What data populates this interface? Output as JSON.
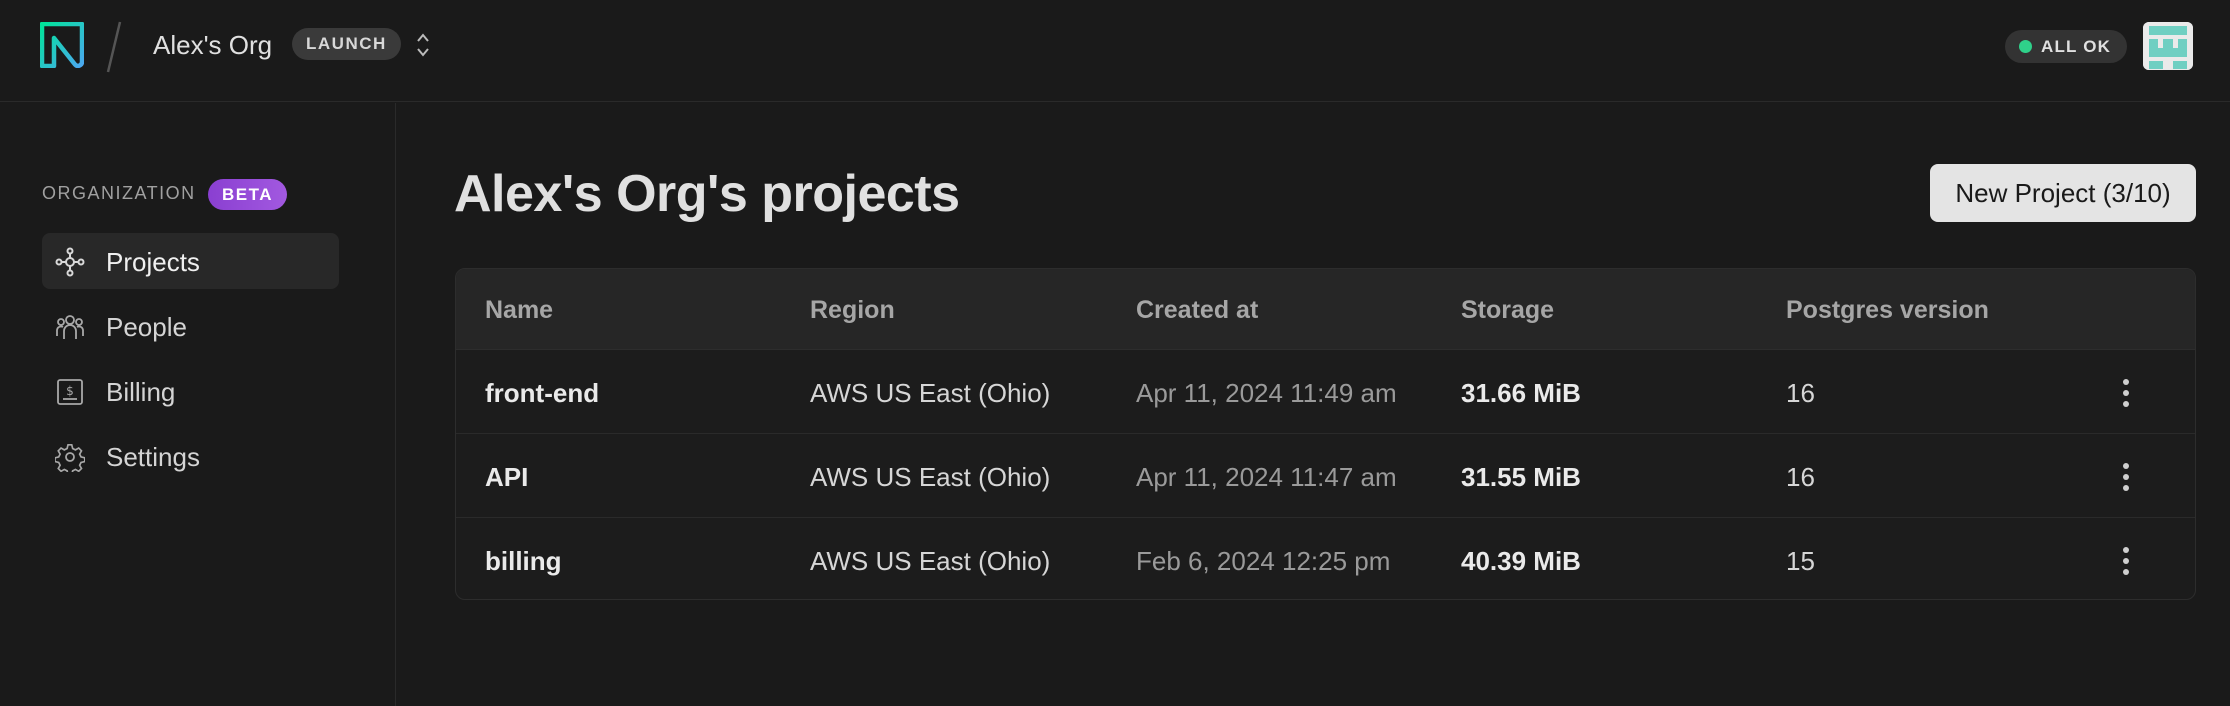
{
  "header": {
    "org_name": "Alex's Org",
    "plan_badge": "LAUNCH",
    "status_label": "ALL OK",
    "status_color": "#2fd18a"
  },
  "sidebar": {
    "section_title": "ORGANIZATION",
    "section_badge": "BETA",
    "items": [
      {
        "label": "Projects",
        "icon": "projects-icon",
        "active": true
      },
      {
        "label": "People",
        "icon": "people-icon",
        "active": false
      },
      {
        "label": "Billing",
        "icon": "billing-icon",
        "active": false
      },
      {
        "label": "Settings",
        "icon": "gear-icon",
        "active": false
      }
    ]
  },
  "main": {
    "title": "Alex's Org's projects",
    "new_project_label": "New Project (3/10)",
    "table": {
      "columns": [
        "Name",
        "Region",
        "Created at",
        "Storage",
        "Postgres version"
      ],
      "rows": [
        {
          "name": "front-end",
          "region": "AWS US East (Ohio)",
          "created": "Apr 11, 2024 11:49 am",
          "storage": "31.66 MiB",
          "pg_version": "16"
        },
        {
          "name": "API",
          "region": "AWS US East (Ohio)",
          "created": "Apr 11, 2024 11:47 am",
          "storage": "31.55 MiB",
          "pg_version": "16"
        },
        {
          "name": "billing",
          "region": "AWS US East (Ohio)",
          "created": "Feb 6, 2024 12:25 pm",
          "storage": "40.39 MiB",
          "pg_version": "15"
        }
      ]
    }
  },
  "colors": {
    "background": "#1a1a1a",
    "brand_gradient_start": "#00e599",
    "brand_gradient_end": "#4ba8f0",
    "beta_badge": "#a259e0"
  }
}
